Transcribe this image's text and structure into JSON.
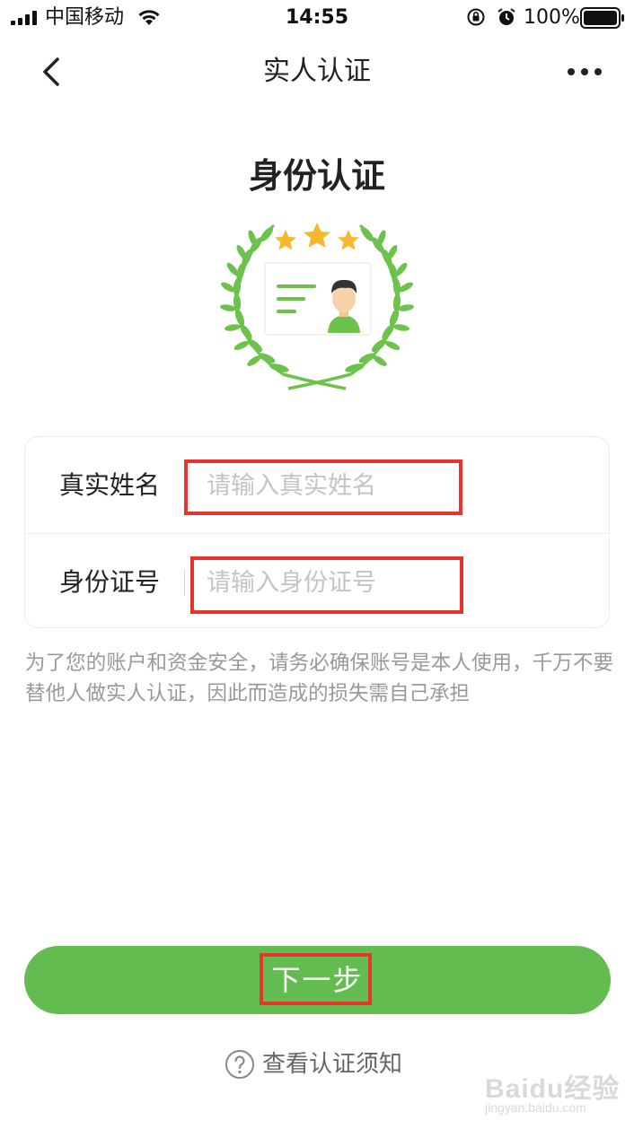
{
  "status_bar": {
    "carrier": "中国移动",
    "time": "14:55",
    "battery": "100%"
  },
  "nav": {
    "title": "实人认证"
  },
  "hero": {
    "heading": "身份认证"
  },
  "form": {
    "name_label": "真实姓名",
    "name_placeholder": "请输入真实姓名",
    "id_label": "身份证号",
    "id_placeholder": "请输入身份证号"
  },
  "disclaimer": "为了您的账户和资金安全，请务必确保账号是本人使用，千万不要替他人做实人认证，因此而造成的损失需自己承担",
  "actions": {
    "next_label": "下一步",
    "help_label": "查看认证须知"
  },
  "watermark": {
    "text": "Baidu经验",
    "sub": "jingyan.baidu.com"
  },
  "colors": {
    "accent": "#62bc50",
    "highlight": "#e8342e",
    "star": "#f5b82e",
    "leaf": "#6cc24a"
  }
}
